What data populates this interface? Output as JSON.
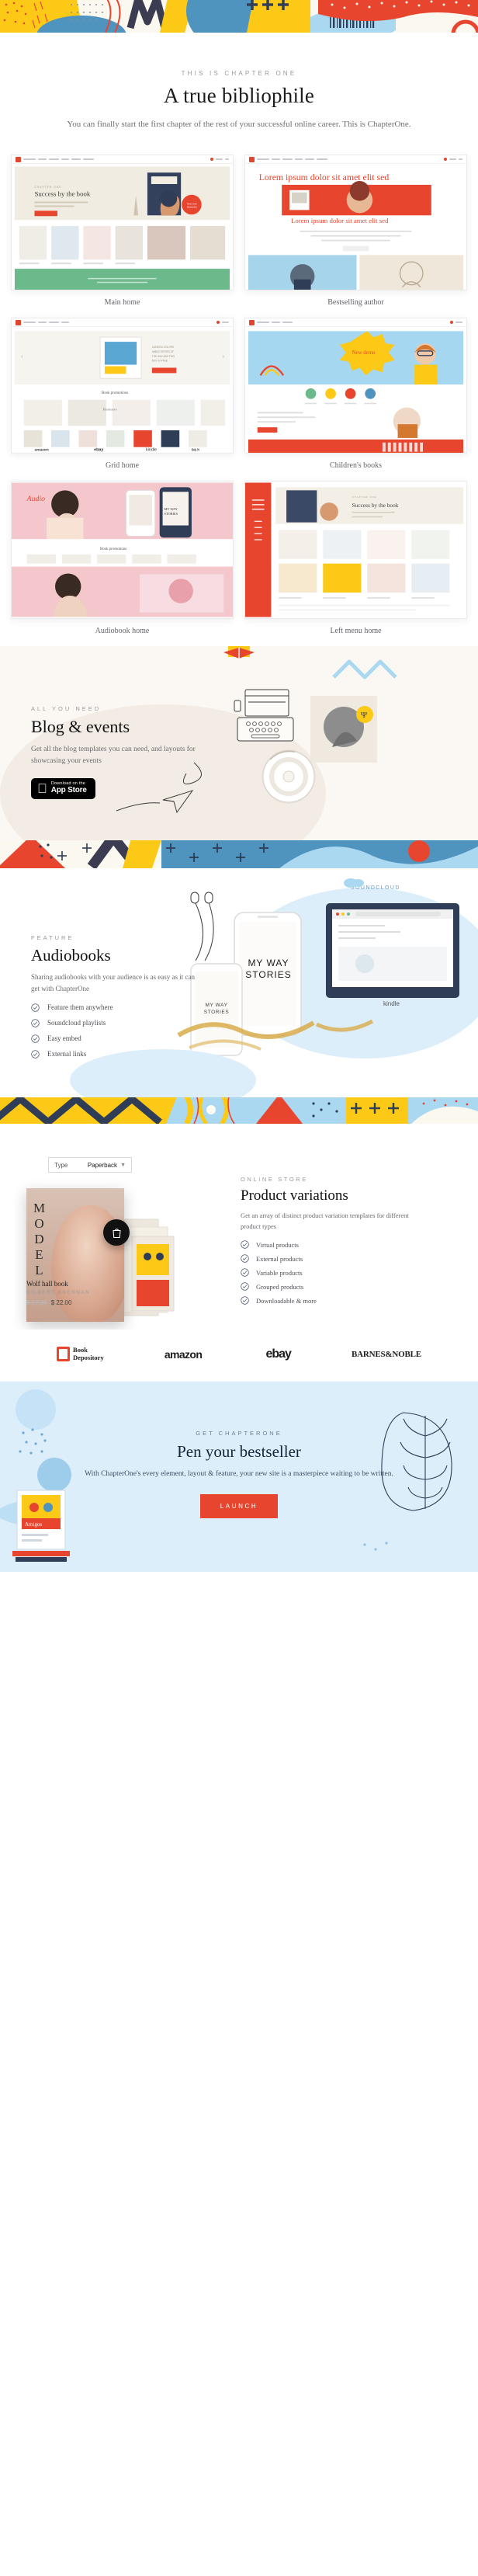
{
  "intro": {
    "eyebrow": "THIS IS CHAPTER ONE",
    "title": "A true bibliophile",
    "paragraph": "You can finally start the first chapter of the rest of your successful online career. This is ChapterOne."
  },
  "demos": [
    {
      "label": "Main home"
    },
    {
      "label": "Bestselling author"
    },
    {
      "label": "Grid home"
    },
    {
      "label": "Children's books"
    },
    {
      "label": "Audiobook home"
    },
    {
      "label": "Left menu home"
    }
  ],
  "demo_inner_text": {
    "bestselling_headline": "Lorem ipsum dolor sit amet elit sed",
    "bestselling_sub": "Lorem ipsum dolor sit amet elit sed",
    "children_badge": "New demo",
    "grid_promo": "Book promotions",
    "store_logos": [
      "amazon",
      "ebay",
      "kindle",
      "BARNES&NOBLE"
    ]
  },
  "blog": {
    "eyebrow": "ALL YOU NEED",
    "title": "Blog & events",
    "paragraph": "Get all the blog templates you can need, and layouts for showcasing your events",
    "appstore_small": "Download on the",
    "appstore_big": "App Store"
  },
  "audiobooks": {
    "eyebrow": "FEATURE",
    "title": "Audiobooks",
    "paragraph": "Sharing audiobooks with your audience is as easy as it can get with ChapterOne",
    "features": [
      "Feature them anywhere",
      "Soundcloud playlists",
      "Easy embed",
      "External links"
    ],
    "soundcloud_label": "SOUNDCLOUD",
    "phone_title": "MY WAY STORIES",
    "phone_title_small": "MY WAY STORIES",
    "kindle_label": "kindle"
  },
  "products": {
    "eyebrow": "ONLINE STORE",
    "title": "Product variations",
    "paragraph": "Get an array of distinct product variation templates for different product types",
    "items": [
      "Virtual products",
      "External products",
      "Variable products",
      "Grouped products",
      "Downloadable & more"
    ],
    "select_label": "Type",
    "select_value": "Paperback",
    "cover_word": "MODEL",
    "book_title": "Wolf hall book",
    "book_author": "GILBERT BRENNAN",
    "book_price_old": "$ 27.00",
    "book_price_new": "$ 22.00",
    "cart_icon": "shopping-bag-icon"
  },
  "logos": {
    "book_depository_line1": "Book",
    "book_depository_line2": "Depository",
    "amazon": "amazon",
    "ebay": "ebay",
    "barnes": "BARNES&NOBLE"
  },
  "cta": {
    "eyebrow": "GET CHAPTERONE",
    "title": "Pen your bestseller",
    "paragraph": "With ChapterOne's every element, layout & feature, your new site is a masterpiece waiting to be written.",
    "button": "LAUNCH"
  },
  "colors": {
    "red": "#e8452f",
    "yellow": "#fbc916",
    "blue": "#4f93bf",
    "light_blue": "#aad8f0",
    "navy": "#2f3d57",
    "cream": "#fbf8f0"
  }
}
